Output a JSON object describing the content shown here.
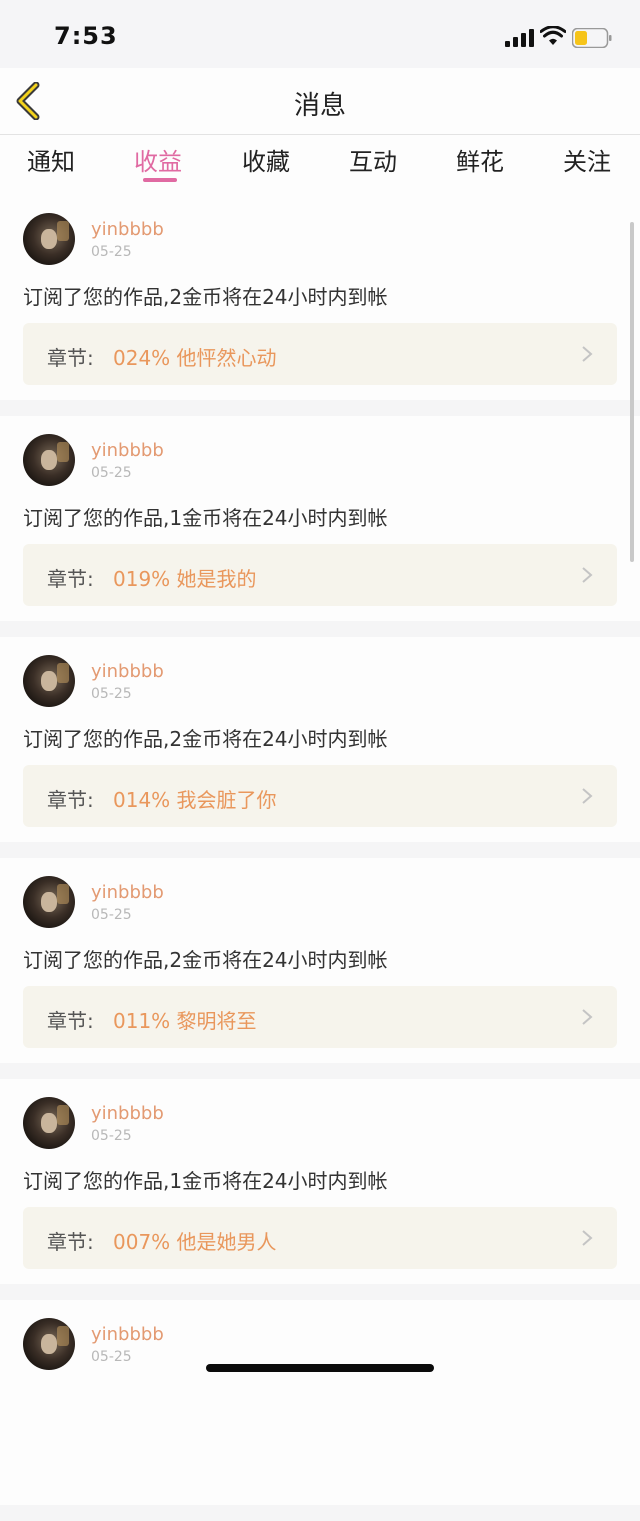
{
  "status_bar": {
    "time": "7:53"
  },
  "nav": {
    "title": "消息"
  },
  "tabs": [
    {
      "label": "通知",
      "active": false
    },
    {
      "label": "收益",
      "active": true
    },
    {
      "label": "收藏",
      "active": false
    },
    {
      "label": "互动",
      "active": false
    },
    {
      "label": "鲜花",
      "active": false
    },
    {
      "label": "关注",
      "active": false
    }
  ],
  "chapter_prefix": "章节:",
  "items": [
    {
      "username": "yinbbbb",
      "date": "05-25",
      "message": "订阅了您的作品,2金币将在24小时内到帐",
      "chapter": "024% 他怦然心动"
    },
    {
      "username": "yinbbbb",
      "date": "05-25",
      "message": "订阅了您的作品,1金币将在24小时内到帐",
      "chapter": "019% 她是我的"
    },
    {
      "username": "yinbbbb",
      "date": "05-25",
      "message": "订阅了您的作品,2金币将在24小时内到帐",
      "chapter": "014% 我会脏了你"
    },
    {
      "username": "yinbbbb",
      "date": "05-25",
      "message": "订阅了您的作品,2金币将在24小时内到帐",
      "chapter": "011% 黎明将至"
    },
    {
      "username": "yinbbbb",
      "date": "05-25",
      "message": "订阅了您的作品,1金币将在24小时内到帐",
      "chapter": "007% 他是她男人"
    },
    {
      "username": "yinbbbb",
      "date": "05-25",
      "message": "",
      "chapter": ""
    }
  ],
  "colors": {
    "accent": "#e06aa2",
    "username": "#e39a72",
    "chapter_title": "#e9975c",
    "battery": "#f6c41a"
  }
}
